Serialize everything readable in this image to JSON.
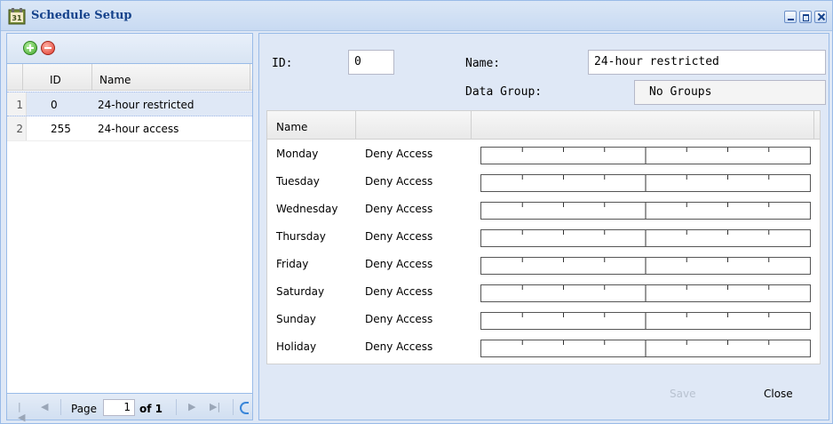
{
  "window": {
    "title": "Schedule Setup"
  },
  "left": {
    "columns": {
      "id": "ID",
      "name": "Name"
    },
    "rows": [
      {
        "num": "1",
        "id": "0",
        "name": "24-hour restricted",
        "selected": true
      },
      {
        "num": "2",
        "id": "255",
        "name": "24-hour access",
        "selected": false
      }
    ],
    "pager": {
      "page_label": "Page",
      "page_value": "1",
      "of_label": "of 1"
    }
  },
  "form": {
    "id_label": "ID:",
    "id_value": "0",
    "name_label": "Name:",
    "name_value": "24-hour restricted",
    "group_label": "Data Group:",
    "group_value": "No Groups"
  },
  "schedule": {
    "header_name": "Name",
    "rows": [
      {
        "day": "Monday",
        "access": "Deny Access"
      },
      {
        "day": "Tuesday",
        "access": "Deny Access"
      },
      {
        "day": "Wednesday",
        "access": "Deny Access"
      },
      {
        "day": "Thursday",
        "access": "Deny Access"
      },
      {
        "day": "Friday",
        "access": "Deny Access"
      },
      {
        "day": "Saturday",
        "access": "Deny Access"
      },
      {
        "day": "Sunday",
        "access": "Deny Access"
      },
      {
        "day": "Holiday",
        "access": "Deny Access"
      }
    ]
  },
  "buttons": {
    "save": "Save",
    "close": "Close"
  },
  "colors": {
    "accent": "#15428b",
    "panel_bg": "#dfe8f6",
    "disabled_text": "#b8c2d0"
  }
}
